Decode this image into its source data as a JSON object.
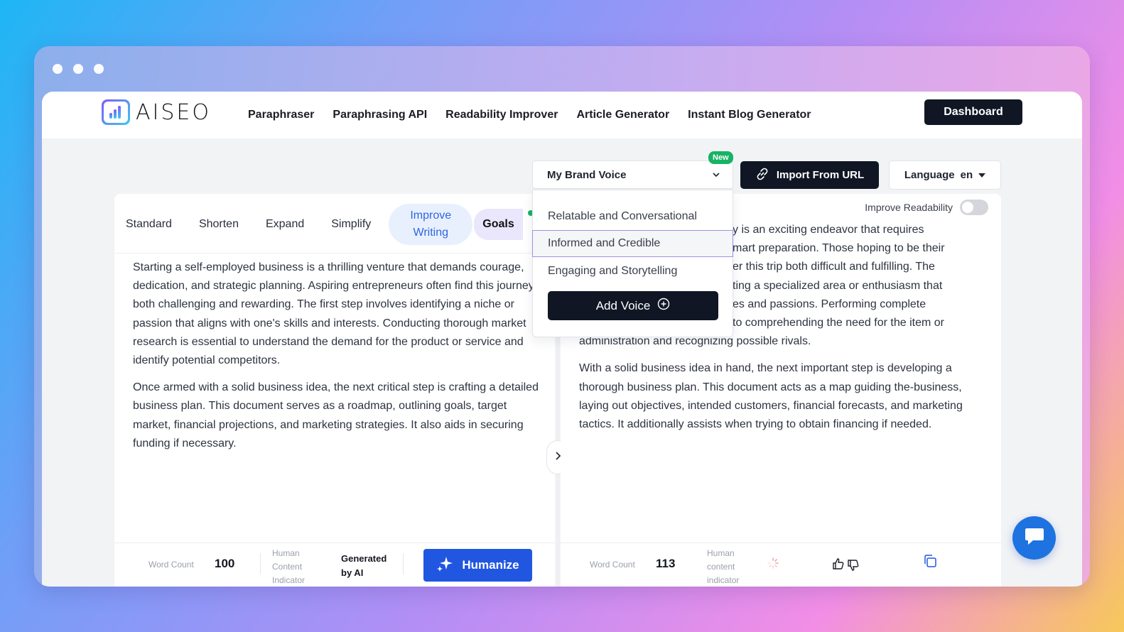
{
  "app": {
    "logo_text": "AISEO"
  },
  "nav": {
    "links": [
      "Paraphraser",
      "Paraphrasing API",
      "Readability Improver",
      "Article Generator",
      "Instant Blog Generator"
    ],
    "dashboard": "Dashboard"
  },
  "toolbar": {
    "brand_voice": "My Brand Voice",
    "new_badge": "New",
    "import": "Import From URL",
    "language_label": "Language",
    "language_value": "en"
  },
  "dropdown": {
    "items": [
      "Relatable and Conversational",
      "Informed and Credible",
      "Engaging and Storytelling"
    ],
    "selected_index": 1,
    "add_voice": "Add Voice"
  },
  "tabs": [
    "Standard",
    "Shorten",
    "Expand",
    "Simplify",
    "Improve Writing",
    "Goals"
  ],
  "active_tab": "Improve Writing",
  "left": {
    "paragraphs": [
      "Starting a self-employed business is a thrilling venture that demands courage, dedication, and strategic planning. Aspiring entrepreneurs often find this journey both challenging and rewarding. The first step involves identifying a niche or passion that aligns with one's skills and interests. Conducting thorough market research is essential to understand the demand for the product or service and identify potential competitors.",
      "Once armed with a solid business idea, the next critical step is crafting a detailed business plan. This document serves as a roadmap, outlining goals, target market, financial projections, and marketing strategies. It also aids in securing funding if necessary."
    ],
    "word_count_label": "Word Count",
    "word_count": "100",
    "hci_label": "Human Content Indicator",
    "hci_value": "Generated by AI",
    "humanize": "Humanize"
  },
  "right": {
    "improve_readability": "Improve Readability",
    "paragraphs": [
      "y is an exciting endeavor that requires",
      "mart preparation. Those hoping to be their",
      "er this trip both difficult and fulfilling. The",
      "ting a specialized area or enthusiasm that",
      "es and passions. Performing complete",
      "to comprehending the need for the item or",
      "administration and recognizing possible rivals.",
      "With a solid business idea in hand, the next important step is developing a thorough business plan. This document acts as a map guiding the-business, laying out objectives, intended customers, financial forecasts, and marketing tactics. It additionally assists when trying to obtain financing if needed."
    ],
    "word_count_label": "Word Count",
    "word_count": "113",
    "hci_label": "Human content indicator"
  }
}
